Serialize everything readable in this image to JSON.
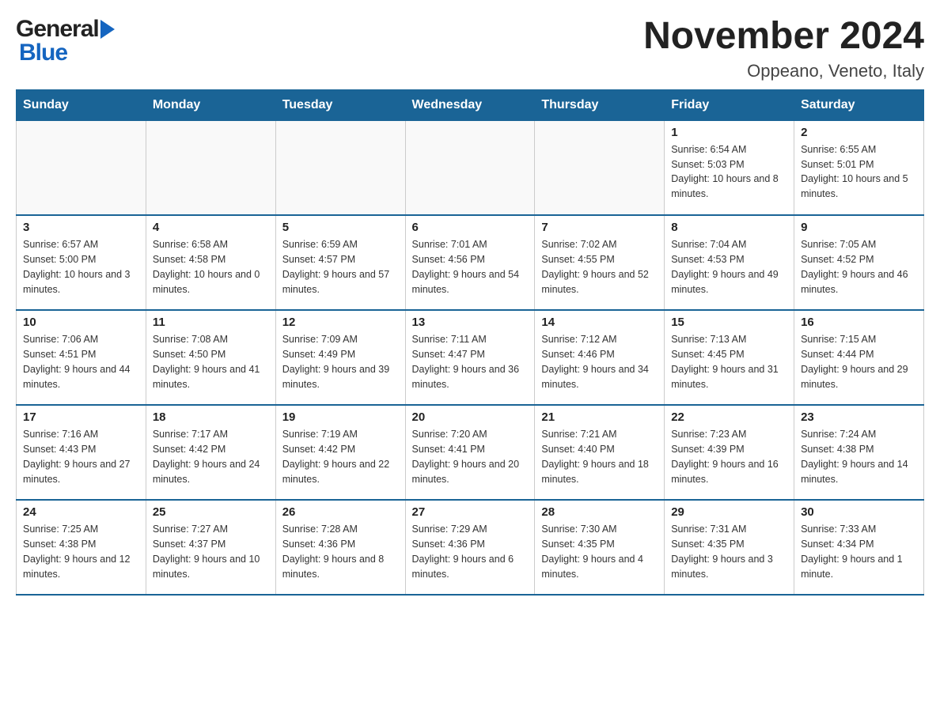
{
  "header": {
    "logo": {
      "general": "General",
      "blue": "Blue"
    },
    "title": "November 2024",
    "subtitle": "Oppeano, Veneto, Italy"
  },
  "weekdays": [
    "Sunday",
    "Monday",
    "Tuesday",
    "Wednesday",
    "Thursday",
    "Friday",
    "Saturday"
  ],
  "weeks": [
    {
      "days": [
        {
          "number": "",
          "empty": true
        },
        {
          "number": "",
          "empty": true
        },
        {
          "number": "",
          "empty": true
        },
        {
          "number": "",
          "empty": true
        },
        {
          "number": "",
          "empty": true
        },
        {
          "number": "1",
          "sunrise": "6:54 AM",
          "sunset": "5:03 PM",
          "daylight": "10 hours and 8 minutes."
        },
        {
          "number": "2",
          "sunrise": "6:55 AM",
          "sunset": "5:01 PM",
          "daylight": "10 hours and 5 minutes."
        }
      ]
    },
    {
      "days": [
        {
          "number": "3",
          "sunrise": "6:57 AM",
          "sunset": "5:00 PM",
          "daylight": "10 hours and 3 minutes."
        },
        {
          "number": "4",
          "sunrise": "6:58 AM",
          "sunset": "4:58 PM",
          "daylight": "10 hours and 0 minutes."
        },
        {
          "number": "5",
          "sunrise": "6:59 AM",
          "sunset": "4:57 PM",
          "daylight": "9 hours and 57 minutes."
        },
        {
          "number": "6",
          "sunrise": "7:01 AM",
          "sunset": "4:56 PM",
          "daylight": "9 hours and 54 minutes."
        },
        {
          "number": "7",
          "sunrise": "7:02 AM",
          "sunset": "4:55 PM",
          "daylight": "9 hours and 52 minutes."
        },
        {
          "number": "8",
          "sunrise": "7:04 AM",
          "sunset": "4:53 PM",
          "daylight": "9 hours and 49 minutes."
        },
        {
          "number": "9",
          "sunrise": "7:05 AM",
          "sunset": "4:52 PM",
          "daylight": "9 hours and 46 minutes."
        }
      ]
    },
    {
      "days": [
        {
          "number": "10",
          "sunrise": "7:06 AM",
          "sunset": "4:51 PM",
          "daylight": "9 hours and 44 minutes."
        },
        {
          "number": "11",
          "sunrise": "7:08 AM",
          "sunset": "4:50 PM",
          "daylight": "9 hours and 41 minutes."
        },
        {
          "number": "12",
          "sunrise": "7:09 AM",
          "sunset": "4:49 PM",
          "daylight": "9 hours and 39 minutes."
        },
        {
          "number": "13",
          "sunrise": "7:11 AM",
          "sunset": "4:47 PM",
          "daylight": "9 hours and 36 minutes."
        },
        {
          "number": "14",
          "sunrise": "7:12 AM",
          "sunset": "4:46 PM",
          "daylight": "9 hours and 34 minutes."
        },
        {
          "number": "15",
          "sunrise": "7:13 AM",
          "sunset": "4:45 PM",
          "daylight": "9 hours and 31 minutes."
        },
        {
          "number": "16",
          "sunrise": "7:15 AM",
          "sunset": "4:44 PM",
          "daylight": "9 hours and 29 minutes."
        }
      ]
    },
    {
      "days": [
        {
          "number": "17",
          "sunrise": "7:16 AM",
          "sunset": "4:43 PM",
          "daylight": "9 hours and 27 minutes."
        },
        {
          "number": "18",
          "sunrise": "7:17 AM",
          "sunset": "4:42 PM",
          "daylight": "9 hours and 24 minutes."
        },
        {
          "number": "19",
          "sunrise": "7:19 AM",
          "sunset": "4:42 PM",
          "daylight": "9 hours and 22 minutes."
        },
        {
          "number": "20",
          "sunrise": "7:20 AM",
          "sunset": "4:41 PM",
          "daylight": "9 hours and 20 minutes."
        },
        {
          "number": "21",
          "sunrise": "7:21 AM",
          "sunset": "4:40 PM",
          "daylight": "9 hours and 18 minutes."
        },
        {
          "number": "22",
          "sunrise": "7:23 AM",
          "sunset": "4:39 PM",
          "daylight": "9 hours and 16 minutes."
        },
        {
          "number": "23",
          "sunrise": "7:24 AM",
          "sunset": "4:38 PM",
          "daylight": "9 hours and 14 minutes."
        }
      ]
    },
    {
      "days": [
        {
          "number": "24",
          "sunrise": "7:25 AM",
          "sunset": "4:38 PM",
          "daylight": "9 hours and 12 minutes."
        },
        {
          "number": "25",
          "sunrise": "7:27 AM",
          "sunset": "4:37 PM",
          "daylight": "9 hours and 10 minutes."
        },
        {
          "number": "26",
          "sunrise": "7:28 AM",
          "sunset": "4:36 PM",
          "daylight": "9 hours and 8 minutes."
        },
        {
          "number": "27",
          "sunrise": "7:29 AM",
          "sunset": "4:36 PM",
          "daylight": "9 hours and 6 minutes."
        },
        {
          "number": "28",
          "sunrise": "7:30 AM",
          "sunset": "4:35 PM",
          "daylight": "9 hours and 4 minutes."
        },
        {
          "number": "29",
          "sunrise": "7:31 AM",
          "sunset": "4:35 PM",
          "daylight": "9 hours and 3 minutes."
        },
        {
          "number": "30",
          "sunrise": "7:33 AM",
          "sunset": "4:34 PM",
          "daylight": "9 hours and 1 minute."
        }
      ]
    }
  ],
  "labels": {
    "sunrise": "Sunrise:",
    "sunset": "Sunset:",
    "daylight": "Daylight:"
  }
}
